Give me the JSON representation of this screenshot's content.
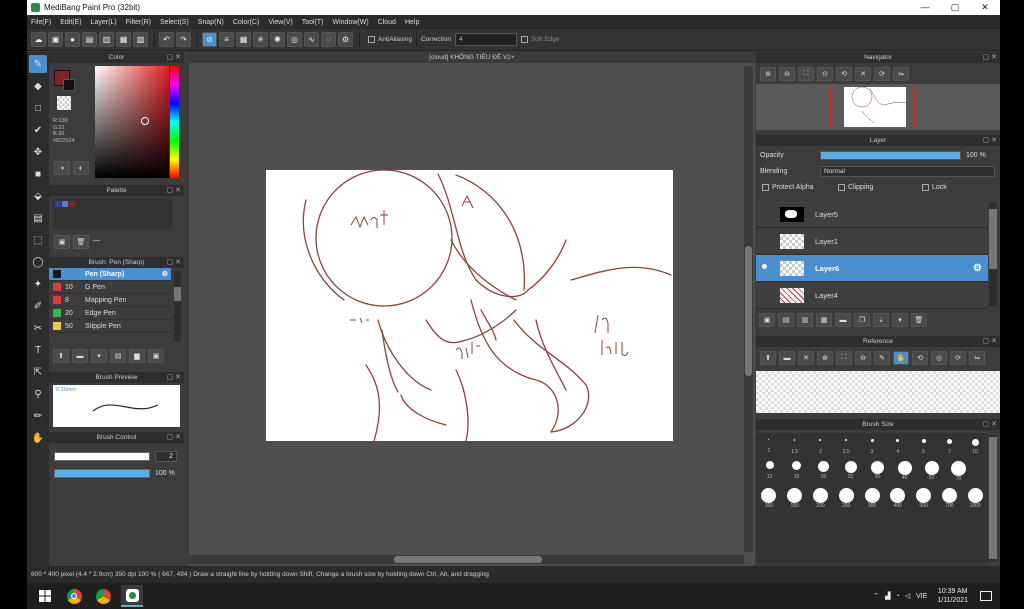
{
  "window": {
    "title": "MediBang Paint Pro (32bit)",
    "minimize": "—",
    "restore": "▢",
    "close": "✕"
  },
  "menu": [
    "File(F)",
    "Edit(E)",
    "Layer(L)",
    "Filter(R)",
    "Select(S)",
    "Snap(N)",
    "Color(C)",
    "View(V)",
    "Tool(T)",
    "Window(W)",
    "Cloud",
    "Help"
  ],
  "toolbar": {
    "antialias_label": "AntiAliasing",
    "correction_label": "Correction",
    "correction_value": "4",
    "soft_edge_label": "Soft Edge"
  },
  "color_panel": {
    "title": "Color",
    "r": "R:130",
    "g": "G:51",
    "b": "B:36",
    "hex": "#822524",
    "primary": "#822524"
  },
  "palette_panel": {
    "title": "Palette",
    "add_label": "—"
  },
  "brush_panel": {
    "title": "Brush: Pen (Sharp)",
    "items": [
      {
        "size": "",
        "name": "Pen (Sharp)",
        "color": "#1a1a1a"
      },
      {
        "size": "10",
        "name": "G Pen",
        "color": "#e23a3a"
      },
      {
        "size": "8",
        "name": "Mapping Pen",
        "color": "#e23a3a"
      },
      {
        "size": "20",
        "name": "Edge Pen",
        "color": "#3ab84a"
      },
      {
        "size": "50",
        "name": "Stipple Pen",
        "color": "#e8d23a"
      }
    ]
  },
  "brush_preview": {
    "title": "Brush Preview",
    "size_label": "0.19mm"
  },
  "brush_control": {
    "title": "Brush Control",
    "size_value": "2",
    "opacity_value": "100 %"
  },
  "canvas": {
    "tab": "[cloud] KHÔNG TIÊU ĐỀ V2+"
  },
  "navigator": {
    "title": "Navigator"
  },
  "layer_panel": {
    "title": "Layer",
    "opacity_label": "Opacity",
    "opacity_value": "100 %",
    "opacity_fill": 1.0,
    "blending_label": "Blending",
    "blending_value": "Normal",
    "protect_alpha": "Protect Alpha",
    "clipping": "Clipping",
    "lock": "Lock",
    "layers": [
      {
        "name": "Layer5",
        "selected": false
      },
      {
        "name": "Layer1",
        "selected": false
      },
      {
        "name": "Layer6",
        "selected": true
      },
      {
        "name": "Layer4",
        "selected": false
      }
    ]
  },
  "reference": {
    "title": "Reference"
  },
  "brush_size": {
    "title": "Brush Size",
    "row1": [
      "1",
      "1.5",
      "2",
      "2.5",
      "3",
      "4",
      "5",
      "7",
      "10"
    ],
    "row2": [
      "12",
      "15",
      "20",
      "25",
      "30",
      "40",
      "50",
      "70"
    ],
    "row3": [
      "100",
      "150",
      "200",
      "250",
      "300",
      "400",
      "500",
      "700",
      "1000"
    ]
  },
  "status": {
    "text": "600 * 400 pixel  (4.4 * 2.9cm)  350 dpi  100 %  ( 667, 494 )  Draw a straight line by holding down Shift, Change a brush size by holding down Ctrl, Alt, and dragging"
  },
  "taskbar": {
    "lang": "VIE",
    "time": "10:39 AM",
    "date": "1/11/2021"
  }
}
